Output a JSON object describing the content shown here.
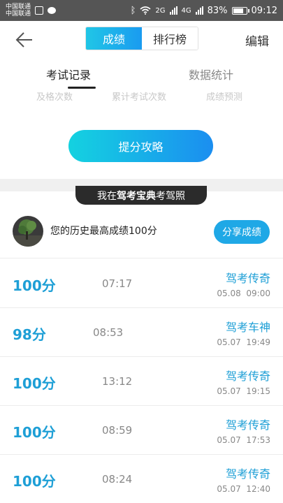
{
  "status_bar": {
    "carrier1": "中国联通",
    "carrier2": "中国联通",
    "net1": "2G",
    "net2": "4G",
    "battery": "83%",
    "battery_level": 0.83,
    "time": "09:12"
  },
  "nav": {
    "tabs": [
      "成绩",
      "排行榜"
    ],
    "active_tab": "成绩",
    "edit_label": "编辑"
  },
  "tabs": {
    "records": "考试记录",
    "stats": "数据统计"
  },
  "stats": {
    "labels": [
      "及格次数",
      "累计考试次数",
      "成绩预测"
    ],
    "tips_button": "提分攻略"
  },
  "toast": {
    "prefix": "我在",
    "brand": "驾考宝典",
    "suffix": "考驾照"
  },
  "best": {
    "text": "您的历史最高成绩100分",
    "share_label": "分享成绩"
  },
  "records": [
    {
      "score": "100分",
      "duration": "07:17",
      "title": "驾考传奇",
      "date": "05.08",
      "time": "09:00"
    },
    {
      "score": "98分",
      "duration": "08:53",
      "title": "驾考车神",
      "date": "05.07",
      "time": "19:49"
    },
    {
      "score": "100分",
      "duration": "13:12",
      "title": "驾考传奇",
      "date": "05.07",
      "time": "19:15"
    },
    {
      "score": "100分",
      "duration": "08:59",
      "title": "驾考传奇",
      "date": "05.07",
      "time": "17:53"
    },
    {
      "score": "100分",
      "duration": "08:24",
      "title": "驾考传奇",
      "date": "05.07",
      "time": "12:40"
    }
  ],
  "colors": {
    "accent": "#1e9fd6",
    "gradient_start": "#14d2e0",
    "gradient_end": "#1b8ef0"
  }
}
